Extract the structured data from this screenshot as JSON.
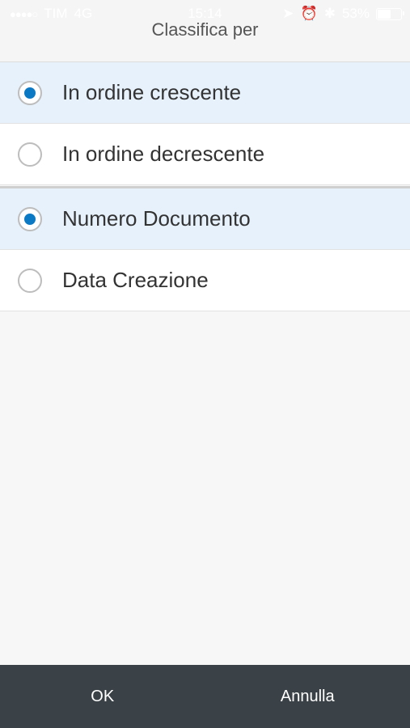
{
  "status_bar": {
    "signal": "●●●●○",
    "carrier": "TIM",
    "network": "4G",
    "time": "15:14",
    "battery_text": "53%",
    "battery_level": 0.53
  },
  "dialog": {
    "title": "Classifica per",
    "order_options": [
      {
        "label": "In ordine crescente",
        "selected": true
      },
      {
        "label": "In ordine decrescente",
        "selected": false
      }
    ],
    "field_options": [
      {
        "label": "Numero Documento",
        "selected": true
      },
      {
        "label": "Data Creazione",
        "selected": false
      }
    ]
  },
  "footer": {
    "ok_label": "OK",
    "cancel_label": "Annulla"
  },
  "colors": {
    "accent": "#0b79c4",
    "selected_row": "#e6f1fb",
    "footer_bg": "#3b4247"
  }
}
